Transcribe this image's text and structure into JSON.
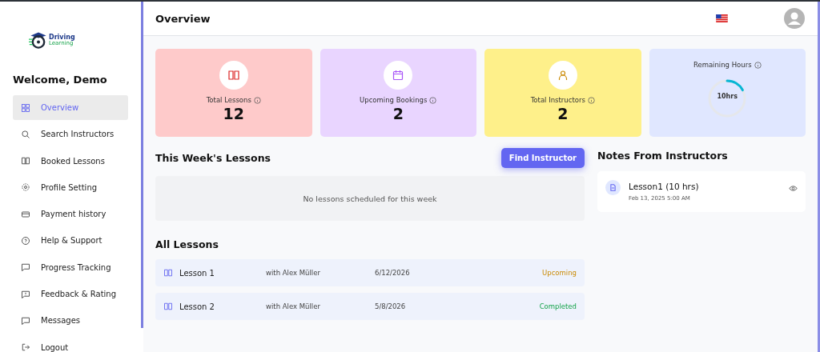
{
  "logo": {
    "line1": "Driving",
    "line2": "Learning"
  },
  "sidebar": {
    "welcome": "Welcome, Demo",
    "items": [
      {
        "label": "Overview",
        "selected": true
      },
      {
        "label": "Search Instructors",
        "selected": false
      },
      {
        "label": "Booked Lessons",
        "selected": false
      },
      {
        "label": "Profile Setting",
        "selected": false
      },
      {
        "label": "Payment history",
        "selected": false
      },
      {
        "label": "Help & Support",
        "selected": false
      },
      {
        "label": "Progress Tracking",
        "selected": false
      },
      {
        "label": "Feedback & Rating",
        "selected": false
      },
      {
        "label": "Messages",
        "selected": false
      },
      {
        "label": "Logout",
        "selected": false
      }
    ]
  },
  "header": {
    "title": "Overview"
  },
  "stats": [
    {
      "kind": "count",
      "label": "Total Lessons",
      "value": "12",
      "color": "#fecaca"
    },
    {
      "kind": "count",
      "label": "Upcoming Bookings",
      "value": "2",
      "color": "#e9d5ff"
    },
    {
      "kind": "count",
      "label": "Total Instructors",
      "value": "2",
      "color": "#fef08a"
    },
    {
      "kind": "ring",
      "label": "Remaining Hours",
      "value": "10hrs",
      "color": "#e0e7ff"
    }
  ],
  "week": {
    "title": "This Week's Lessons",
    "button": "Find Instructor",
    "empty": "No lessons scheduled for this week"
  },
  "all_lessons": {
    "title": "All Lessons",
    "rows": [
      {
        "name": "Lesson 1",
        "instructor": "with Alex Müller",
        "date": "6/12/2026",
        "status": "Upcoming",
        "kind": "upcoming"
      },
      {
        "name": "Lesson 2",
        "instructor": "with Alex Müller",
        "date": "5/8/2026",
        "status": "Completed",
        "kind": "completed"
      }
    ]
  },
  "notes": {
    "title": "Notes From Instructors",
    "items": [
      {
        "title": "Lesson1 (10 hrs)",
        "date": "Feb 13, 2025 5:00 AM"
      }
    ]
  }
}
